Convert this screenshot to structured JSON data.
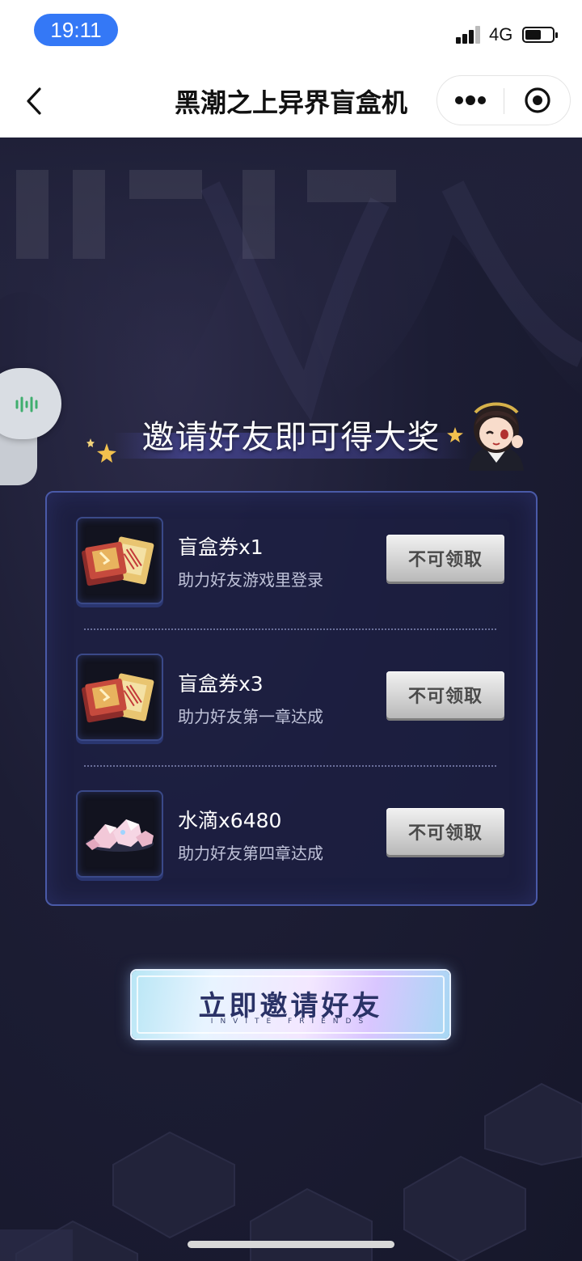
{
  "status_bar": {
    "time": "19:11",
    "network": "4G",
    "battery_level": 0.6
  },
  "nav": {
    "title": "黑潮之上异界盲盒机",
    "back_icon": "chevron-left-icon",
    "more_icon": "more-dots-icon",
    "close_icon": "target-circle-icon"
  },
  "side_widget": {
    "icon": "voice-wave-icon"
  },
  "header": {
    "title": "邀请好友即可得大奖"
  },
  "rewards": [
    {
      "name": "盲盒券x1",
      "desc": "助力好友游戏里登录",
      "button": "不可领取",
      "icon": "ticket-icon"
    },
    {
      "name": "盲盒券x3",
      "desc": "助力好友第一章达成",
      "button": "不可领取",
      "icon": "ticket-icon"
    },
    {
      "name": "水滴x6480",
      "desc": "助力好友第四章达成",
      "button": "不可领取",
      "icon": "crystal-icon"
    }
  ],
  "invite_button": {
    "label": "立即邀请好友",
    "sub": "INVITE FRIENDS"
  },
  "colors": {
    "accent_blue": "#3478f6",
    "panel_border": "#4a5aa8",
    "background": "#1b1c33"
  }
}
